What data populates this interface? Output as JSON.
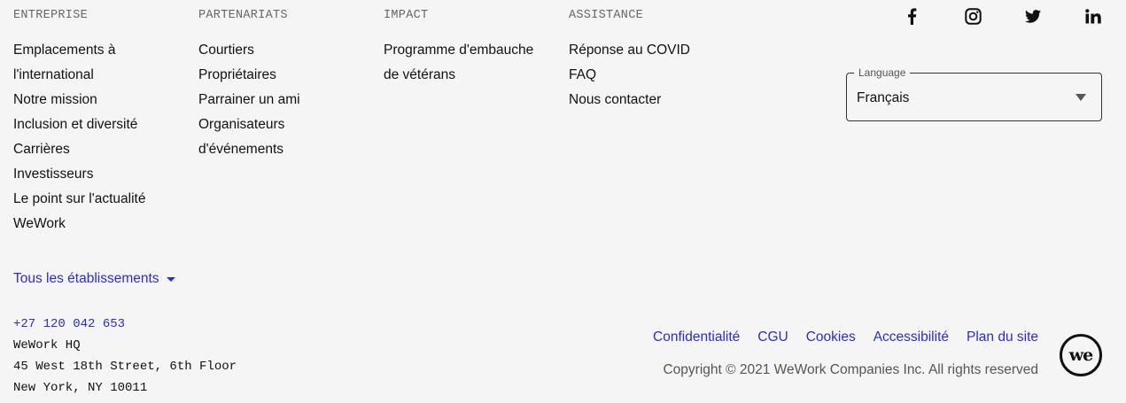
{
  "columns": [
    {
      "heading": "ENTREPRISE",
      "items": [
        "Emplacements à l'international",
        "Notre mission",
        "Inclusion et diversité",
        "Carrières",
        "Investisseurs",
        "Le point sur l'actualité WeWork"
      ]
    },
    {
      "heading": "PARTENARIATS",
      "items": [
        "Courtiers",
        "Propriétaires",
        "Parrainer un ami",
        "Organisateurs d'événements"
      ]
    },
    {
      "heading": "IMPACT",
      "items": [
        "Programme d'embauche de vétérans"
      ]
    },
    {
      "heading": "ASSISTANCE",
      "items": [
        "Réponse au COVID",
        "FAQ",
        "Nous contacter"
      ]
    }
  ],
  "social": [
    "facebook-icon",
    "instagram-icon",
    "twitter-icon",
    "linkedin-icon"
  ],
  "language": {
    "legend": "Language",
    "selected": "Français"
  },
  "all_locations": "Tous les établissements",
  "address": {
    "phone": "+27 120 042 653",
    "line1": "WeWork HQ",
    "line2": "45 West 18th Street, 6th Floor",
    "line3": "New York, NY 10011"
  },
  "legal": [
    "Confidentialité",
    "CGU",
    "Cookies",
    "Accessibilité",
    "Plan du site"
  ],
  "copyright": "Copyright © 2021 WeWork Companies Inc. All rights reserved",
  "logo_text": "we",
  "colors": {
    "link": "#2b2bd1",
    "text": "#111111",
    "muted": "#666666",
    "background": "#f5f5f5"
  }
}
